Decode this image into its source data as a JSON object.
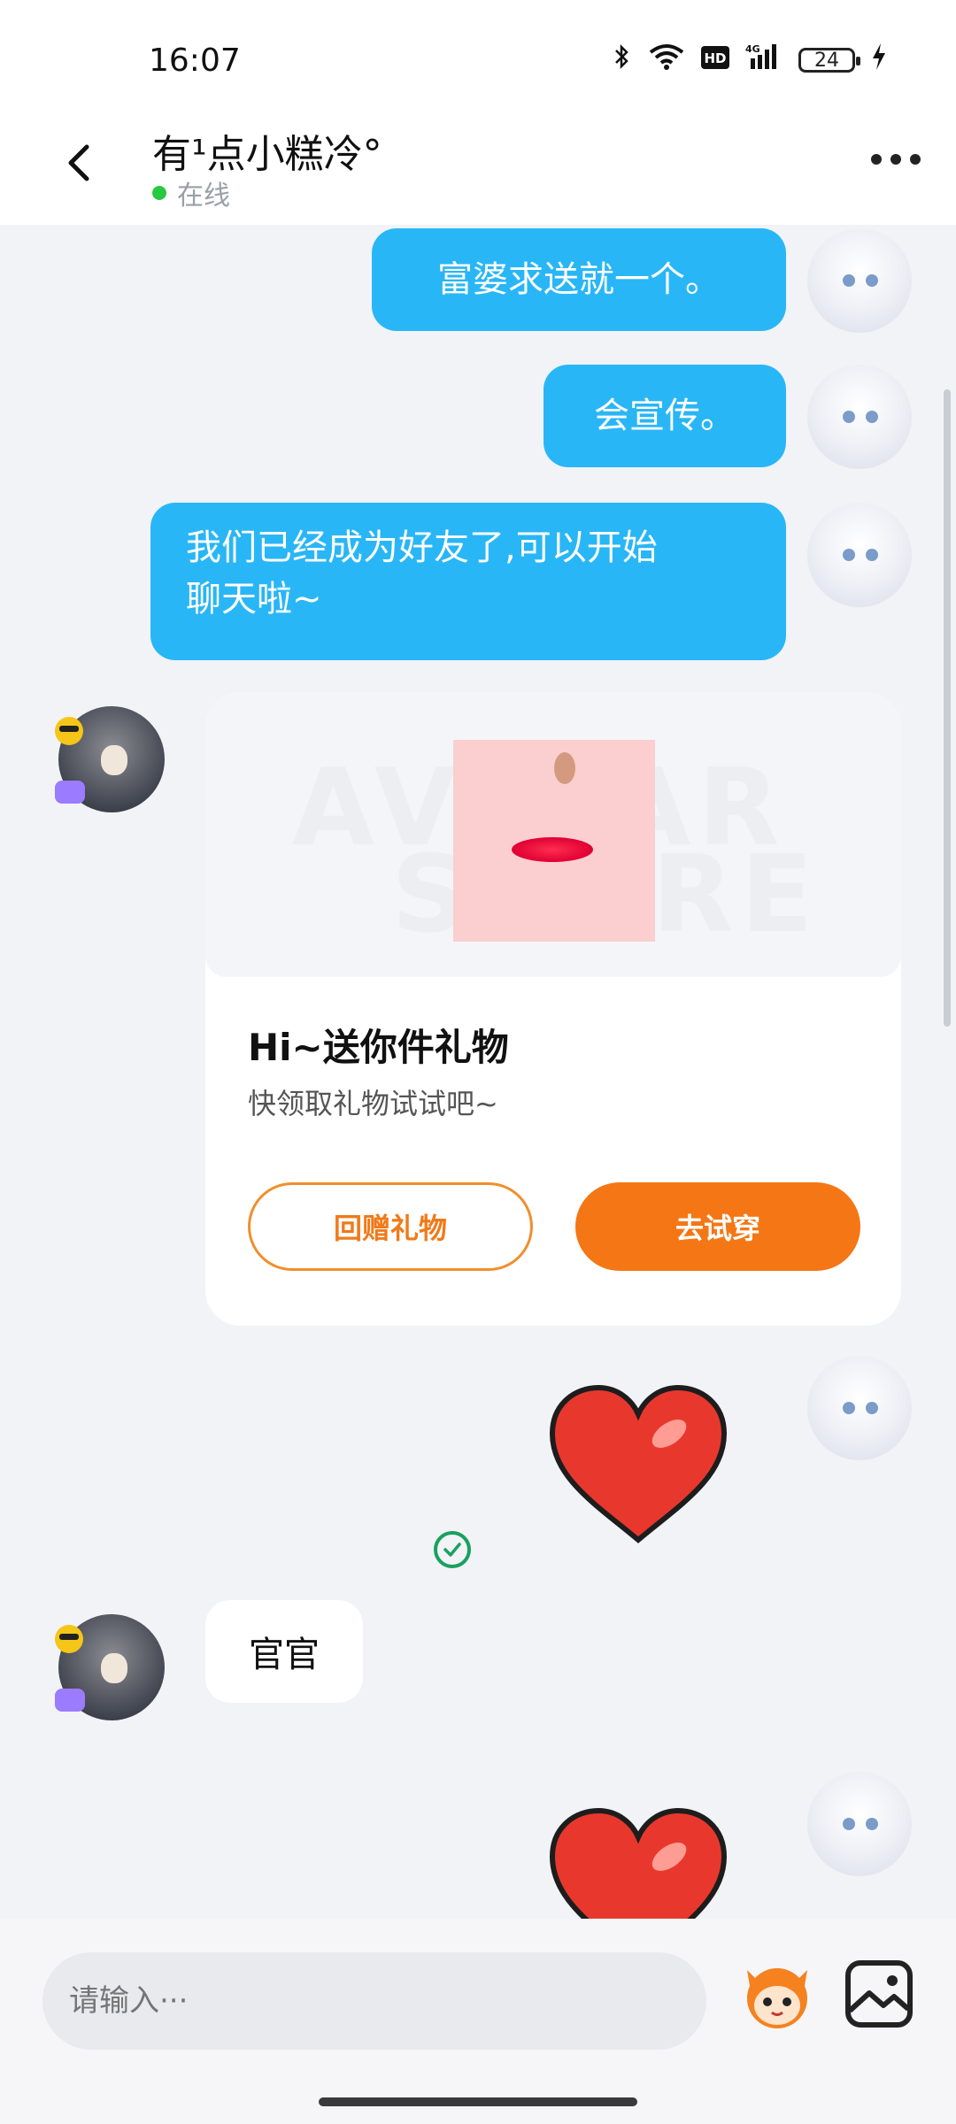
{
  "status_bar": {
    "time": "16:07",
    "battery": "24"
  },
  "header": {
    "title": "有¹点小糕冷°",
    "status": "在线"
  },
  "messages": [
    {
      "side": "right",
      "text": "富婆求送就一个。"
    },
    {
      "side": "right",
      "text": "会宣传。"
    },
    {
      "side": "right",
      "text": "我们已经成为好友了,可以开始\n聊天啦~"
    }
  ],
  "gift_card": {
    "watermark_line1": "AVATAR",
    "watermark_line2": "STORE",
    "title": "Hi~送你件礼物",
    "subtitle": "快领取礼物试试吧~",
    "return_gift_label": "回赠礼物",
    "try_on_label": "去试穿"
  },
  "reply": {
    "text": "官官"
  },
  "input": {
    "placeholder": "请输入···"
  },
  "colors": {
    "bubble_blue": "#29b6f6",
    "accent_orange": "#f57614",
    "online_green": "#28c840"
  },
  "icons": [
    "back-arrow-icon",
    "more-icon",
    "bluetooth-icon",
    "wifi-icon",
    "hd-icon",
    "signal-4g-icon",
    "battery-icon",
    "charging-icon",
    "heart-sticker-icon",
    "check-circle-icon",
    "mascot-emoji-icon",
    "image-icon"
  ]
}
